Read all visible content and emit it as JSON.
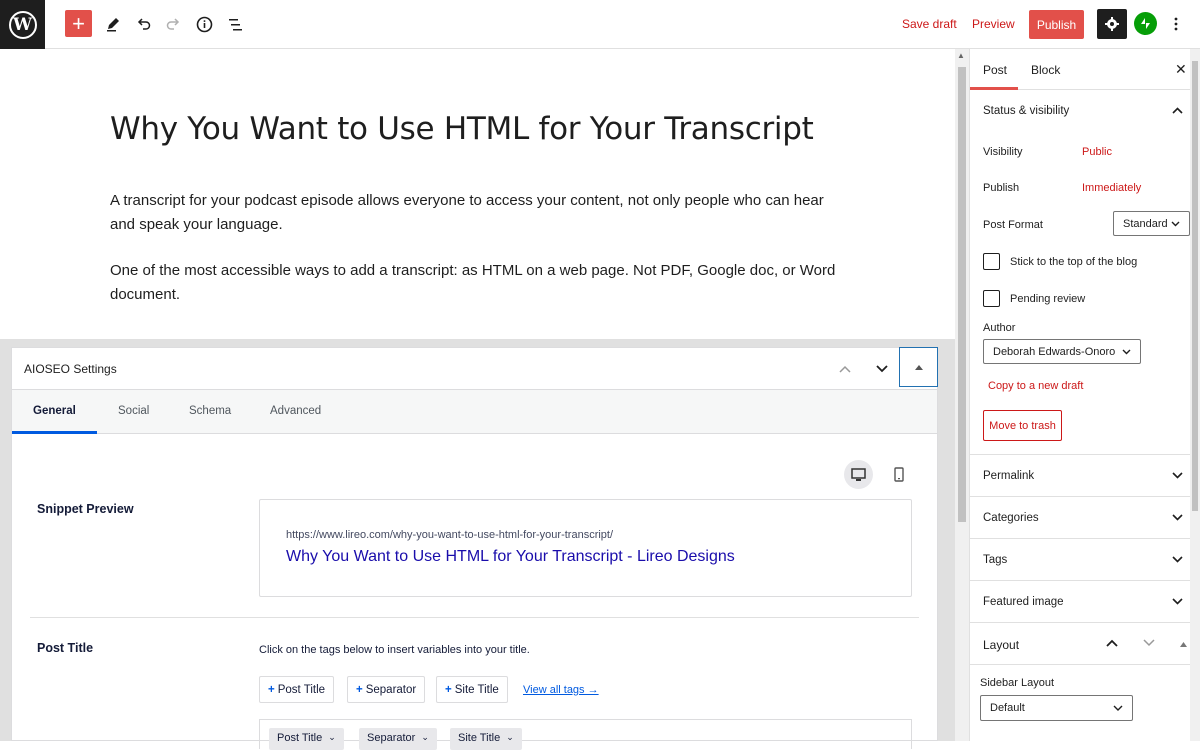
{
  "toolbar": {
    "logo_letter": "W",
    "add_symbol": "+",
    "save_draft_label": "Save draft",
    "preview_label": "Preview",
    "publish_label": "Publish",
    "icons": [
      "pencil-icon",
      "undo-icon",
      "redo-icon",
      "info-icon",
      "list-view-icon",
      "gear-icon",
      "jetpack-icon",
      "more-options-icon"
    ]
  },
  "post": {
    "title": "Why You Want to Use HTML for Your Transcript",
    "paragraphs": [
      "A transcript for your podcast episode allows everyone to access your content, not only people who can hear and speak your language.",
      "One of the most accessible ways to add a transcript: as HTML on a web page. Not PDF, Google doc, or Word document."
    ]
  },
  "aioseo": {
    "title": "AIOSEO Settings",
    "tabs": [
      "General",
      "Social",
      "Schema",
      "Advanced"
    ],
    "active_tab": "General",
    "snippet_label": "Snippet Preview",
    "snippet_url": "https://www.lireo.com/why-you-want-to-use-html-for-your-transcript/",
    "snippet_title": "Why You Want to Use HTML for Your Transcript - Lireo Designs",
    "post_title_label": "Post Title",
    "post_title_hint": "Click on the tags below to insert variables into your title.",
    "tag_buttons": [
      "Post Title",
      "Separator",
      "Site Title"
    ],
    "view_all_tags": "View all tags →",
    "title_chips": [
      "Post Title",
      "Separator",
      "Site Title"
    ]
  },
  "sidebar": {
    "tabs": [
      "Post",
      "Block"
    ],
    "active_tab": "Post",
    "status_section": "Status & visibility",
    "visibility_label": "Visibility",
    "visibility_value": "Public",
    "publish_label": "Publish",
    "publish_value": "Immediately",
    "post_format_label": "Post Format",
    "post_format_value": "Standard",
    "sticky_label": "Stick to the top of the blog",
    "pending_label": "Pending review",
    "author_label": "Author",
    "author_value": "Deborah Edwards-Onoro",
    "copy_draft": "Copy to a new draft",
    "move_trash": "Move to trash",
    "sections": [
      "Permalink",
      "Categories",
      "Tags",
      "Featured image"
    ],
    "layout_section": "Layout",
    "sidebar_layout_label": "Sidebar Layout",
    "sidebar_layout_value": "Default"
  },
  "colors": {
    "accent": "#e2504a",
    "link_red": "#cc1818",
    "aioseo_blue": "#005ae0",
    "snippet_link": "#1a0dab"
  }
}
